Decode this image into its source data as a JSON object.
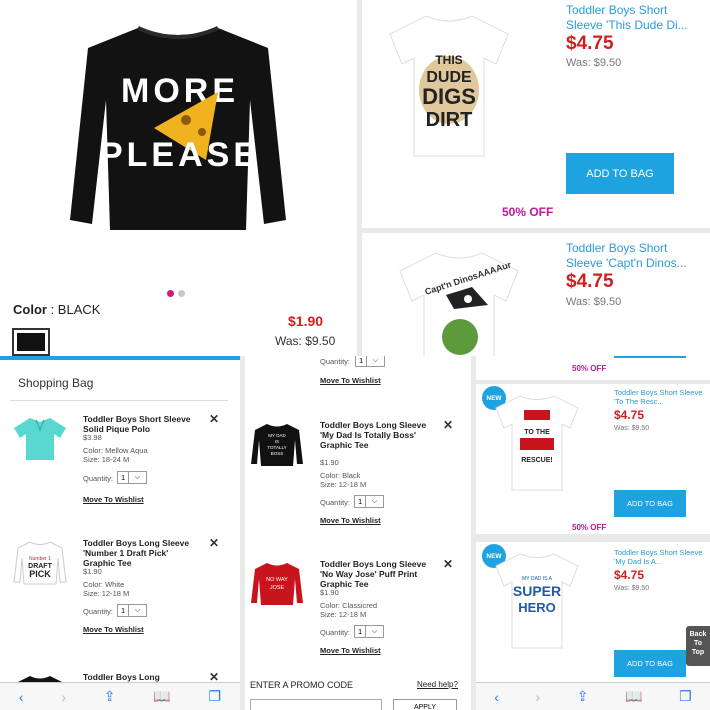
{
  "main_product": {
    "shirt_text_top": "MORE",
    "shirt_text_bottom": "PLEASE",
    "color_label": "Color",
    "color_value": "BLACK",
    "sale_price": "$1.90",
    "was_price": "Was: $9.50"
  },
  "top_cards": [
    {
      "title": "Toddler Boys Short Sleeve 'This Dude Di...",
      "price": "$4.75",
      "was": "Was: $9.50",
      "button": "ADD TO BAG",
      "discount": "50% OFF",
      "shirt_text": [
        "THIS",
        "DUDE",
        "DIGS",
        "DIRT"
      ]
    },
    {
      "title": "Toddler Boys Short Sleeve 'Capt'n Dinos...",
      "price": "$4.75",
      "was": "Was: $9.50",
      "shirt_text": "Capt'n DinosAAAAur"
    }
  ],
  "bag": {
    "title": "Shopping Bag",
    "quantity_label": "Quantity:",
    "move_label": "Move To Wishlist",
    "items_a": [
      {
        "name": "Toddler Boys Short Sleeve Solid Pique Polo",
        "price": "$3.98",
        "color": "Color: Mellow Aqua",
        "size": "Size: 18-24 M",
        "qty": "1"
      },
      {
        "name": "Toddler Boys Long Sleeve 'Number 1 Draft Pick' Graphic Tee",
        "price": "$1.90",
        "color": "Color: White",
        "size": "Size: 12-18 M",
        "qty": "1",
        "shirt_text": [
          "Number 1",
          "DRAFT",
          "PICK"
        ]
      },
      {
        "name": "Toddler Boys Long"
      }
    ],
    "items_b": [
      {
        "name": "Toddler Boys Long Sleeve 'My Dad Is Totally Boss' Graphic Tee",
        "price": "$1.90",
        "color": "Color: Black",
        "size": "Size: 12-18 M",
        "qty": "1",
        "shirt_text": [
          "MY DAD",
          "IS",
          "TOTALLY",
          "BOSS"
        ]
      },
      {
        "name": "Toddler Boys Long Sleeve 'No Way Jose' Puff Print Graphic Tee",
        "price": "$1.90",
        "color": "Color: Classicred",
        "size": "Size: 12-18 M",
        "qty": "1",
        "shirt_text": [
          "NO WAY",
          "JOSE"
        ]
      }
    ],
    "top_qty": "1",
    "promo_label": "ENTER A PROMO CODE",
    "need_help": "Need help?",
    "apply": "APPLY"
  },
  "right_cards": [
    {
      "badge": "NEW",
      "title": "Toddler Boys Short Sleeve 'To The Resc...",
      "price": "$4.75",
      "was": "Was: $9.50",
      "button": "ADD TO BAG",
      "discount": "50% OFF",
      "shirt_text": [
        "TO THE",
        "RESCUE!"
      ]
    },
    {
      "badge": "NEW",
      "title": "Toddler Boys Short Sleeve 'My Dad Is A...",
      "price": "$4.75",
      "was": "Was: $9.50",
      "button": "ADD TO BAG",
      "shirt_text": [
        "MY DAD IS A",
        "SUPER",
        "HERO"
      ]
    }
  ],
  "right_top_discount": "50% OFF",
  "back_to_top": [
    "Back",
    "To",
    "Top"
  ],
  "colors": {
    "accent_blue": "#1ea3e0",
    "price_red": "#d11f1f",
    "discount_magenta": "#c0179a",
    "link_blue": "#2b9ad6"
  },
  "icons": [
    "back-icon",
    "forward-icon",
    "share-icon",
    "bookmarks-icon",
    "tabs-icon",
    "close-icon",
    "chevron-down-icon"
  ]
}
